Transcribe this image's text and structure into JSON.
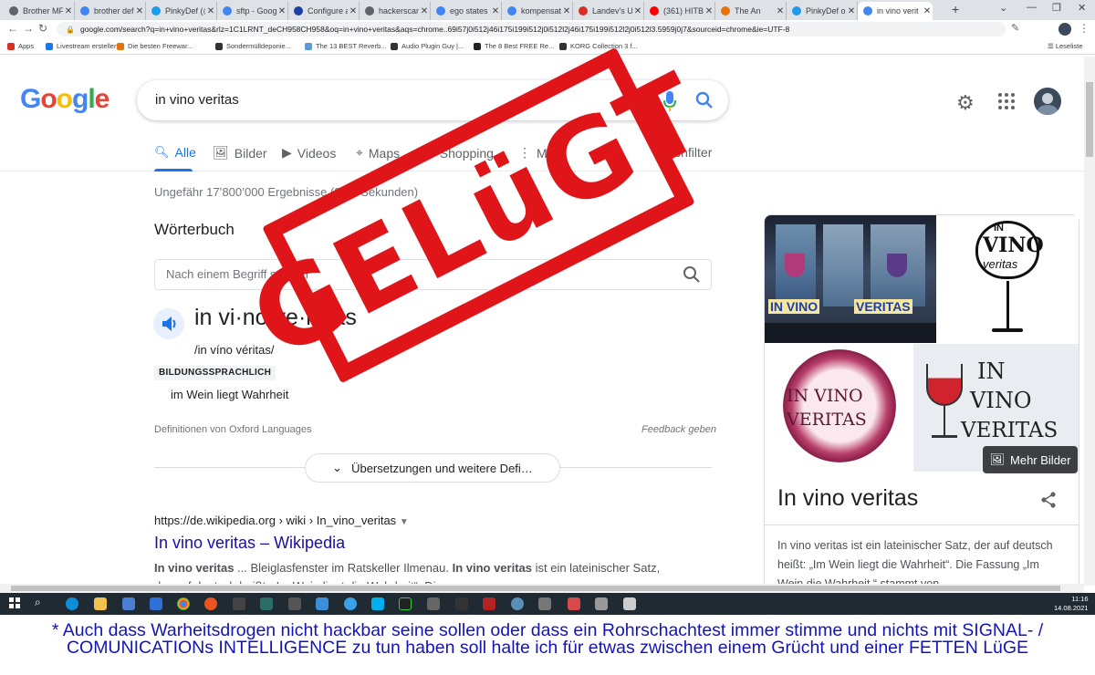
{
  "browser": {
    "tabs": [
      {
        "label": "Brother MF",
        "color": "#5f6368"
      },
      {
        "label": "brother def",
        "color": "#4285f4"
      },
      {
        "label": "PinkyDef (@",
        "color": "#1d9bf0"
      },
      {
        "label": "sftp - Goog",
        "color": "#4285f4"
      },
      {
        "label": "Configure a",
        "color": "#1d3fa6"
      },
      {
        "label": "hackerscan",
        "color": "#5f6368"
      },
      {
        "label": "ego states",
        "color": "#4285f4"
      },
      {
        "label": "kompensati",
        "color": "#4285f4"
      },
      {
        "label": "Landev's Ut",
        "color": "#d93025"
      },
      {
        "label": "(361) HITB",
        "color": "#ff0000"
      },
      {
        "label": "The An",
        "color": "#e8710a"
      },
      {
        "label": "PinkyDef on",
        "color": "#1d9bf0"
      },
      {
        "label": "in vino verit",
        "color": "#4285f4"
      }
    ],
    "close_glyph": "✕",
    "new_tab": "+",
    "url": "google.com/search?q=in+vino+veritas&rlz=1C1LRNT_deCH958CH958&oq=in+vino+veritas&aqs=chrome..69i57j0i512j46i175i199i512j0i512l2j46i175i199i512l2j0i512l3.5959j0j7&sourceid=chrome&ie=UTF-8",
    "bookmarks": [
      {
        "label": "Apps",
        "color": "#d93025"
      },
      {
        "label": "Livestream erstellen",
        "color": "#1877f2"
      },
      {
        "label": "Die besten Freewar...",
        "color": "#e8710a"
      },
      {
        "label": "Sondermülldeponie...",
        "color": "#333333"
      },
      {
        "label": "The 13 BEST Reverb...",
        "color": "#5a9bd5"
      },
      {
        "label": "Audio Plugin Guy |...",
        "color": "#333333"
      },
      {
        "label": "The 8 Best FREE Re...",
        "color": "#222222"
      },
      {
        "label": "KORG Collection 3 f...",
        "color": "#333333"
      }
    ],
    "reading_list": "Leseliste"
  },
  "google": {
    "logo": [
      "G",
      "o",
      "o",
      "g",
      "l",
      "e"
    ],
    "query": "in vino veritas",
    "tabs": [
      "Alle",
      "Bilder",
      "Videos",
      "Maps",
      "Shopping",
      "Mehr"
    ],
    "tools": "Suchfilter",
    "stats": "Ungefähr 17’800’000 Ergebnisse (0.69 Sekunden)"
  },
  "dictionary": {
    "heading": "Wörterbuch",
    "placeholder": "Nach einem Begriff suchen",
    "word": "in vi·no ve·ri·tas",
    "pronunciation": "/in víno véritas/",
    "register": "BILDUNGSSPRACHLICH",
    "meaning": "im Wein liegt Wahrheit",
    "source": "Definitionen von Oxford Languages",
    "feedback": "Feedback geben",
    "more": "Übersetzungen und weitere Defi…"
  },
  "result": {
    "url": "https://de.wikipedia.org › wiki › In_vino_veritas",
    "title": "In vino veritas – Wikipedia",
    "snippet_b1": "In vino veritas",
    "snippet_t1": " ... Bleiglasfenster im Ratskeller Ilmenau. ",
    "snippet_b2": "In vino veritas",
    "snippet_t2": " ist ein lateinischer Satz,",
    "snippet_line2": "der auf deutsch heißt: „Im Wein liegt die Wahrheit“. Die"
  },
  "knowledge_panel": {
    "images": [
      {
        "text_a": "IN VINO",
        "text_b": "VERITAS"
      },
      {
        "text_a": "IN",
        "text_b": "VINO",
        "text_c": "veritas"
      },
      {
        "text_a": "IN VINO",
        "text_b": "VERITAS"
      },
      {
        "text_a": "IN",
        "text_b": "VINO",
        "text_c": "VERITAS"
      }
    ],
    "more_images": "Mehr Bilder",
    "title": "In vino veritas",
    "description": "In vino veritas ist ein lateinischer Satz, der auf deutsch heißt: „Im Wein liegt die Wahrheit“. Die Fassung „Im Wein die Wahrheit.“ stammt von"
  },
  "taskbar": {
    "time": "11:16",
    "date": "14.08.2021"
  },
  "stamp": {
    "text": "GELüGT",
    "color": "#e0151a"
  },
  "caption": {
    "text": "* Auch dass Warheitsdrogen nicht hackbar seine sollen oder dass ein Rohrschachtest immer stimme und nichts mit SIGNAL- / COMUNICATIONs INTELLIGENCE zu tun haben soll halte ich für etwas zwischen einem Grücht und einer FETTEN LüGE"
  }
}
